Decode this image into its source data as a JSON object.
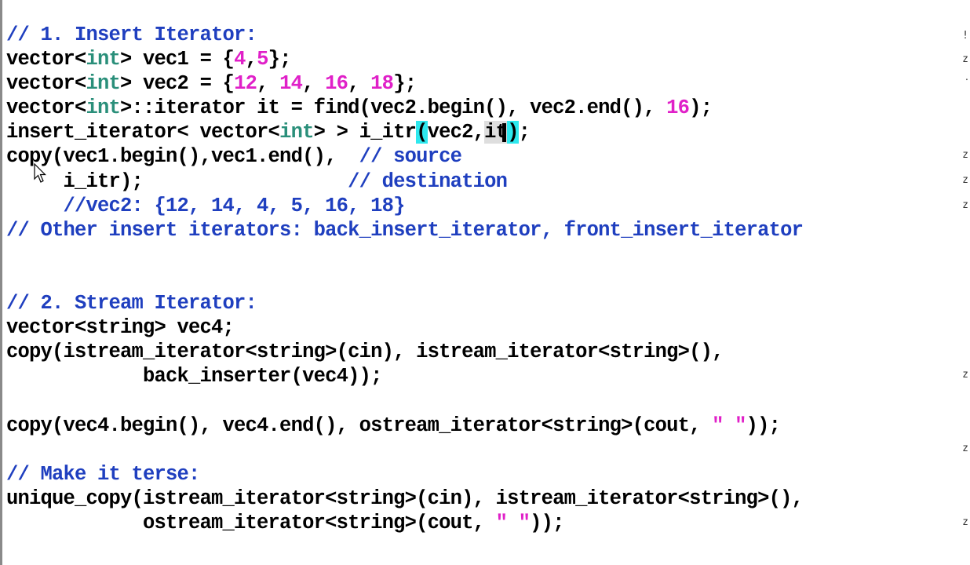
{
  "lines": [
    {
      "id": "l1",
      "parts": [
        {
          "t": "// 1. Insert Iterator:",
          "c": "cm"
        }
      ]
    },
    {
      "id": "l2",
      "parts": [
        {
          "t": "vector<"
        },
        {
          "t": "int",
          "c": "kw"
        },
        {
          "t": "> vec1 = {"
        },
        {
          "t": "4",
          "c": "num"
        },
        {
          "t": ","
        },
        {
          "t": "5",
          "c": "num"
        },
        {
          "t": "};"
        }
      ]
    },
    {
      "id": "l3",
      "parts": [
        {
          "t": "vector<"
        },
        {
          "t": "int",
          "c": "kw"
        },
        {
          "t": "> vec2 = {"
        },
        {
          "t": "12",
          "c": "num"
        },
        {
          "t": ", "
        },
        {
          "t": "14",
          "c": "num"
        },
        {
          "t": ", "
        },
        {
          "t": "16",
          "c": "num"
        },
        {
          "t": ", "
        },
        {
          "t": "18",
          "c": "num"
        },
        {
          "t": "};"
        }
      ]
    },
    {
      "id": "l4",
      "parts": [
        {
          "t": "vector<"
        },
        {
          "t": "int",
          "c": "kw"
        },
        {
          "t": ">::iterator it = find(vec2.begin(), vec2.end(), "
        },
        {
          "t": "16",
          "c": "num"
        },
        {
          "t": ");"
        }
      ]
    },
    {
      "id": "l5",
      "parts": [
        {
          "t": "insert_iterator< vector<"
        },
        {
          "t": "int",
          "c": "kw"
        },
        {
          "t": "> > i_itr"
        },
        {
          "t": "(",
          "c": "hl-cyan"
        },
        {
          "t": "vec2,"
        },
        {
          "t": "it",
          "c": "hl-gray"
        },
        {
          "t": "CARET"
        },
        {
          "t": ")",
          "c": "hl-cyan"
        },
        {
          "t": ";"
        }
      ]
    },
    {
      "id": "l6",
      "parts": [
        {
          "t": "copy(vec1.begin(),vec1.end(),  "
        },
        {
          "t": "// source",
          "c": "cm"
        }
      ]
    },
    {
      "id": "l7",
      "parts": [
        {
          "t": "     i_itr);                  "
        },
        {
          "t": "// destination",
          "c": "cm"
        }
      ]
    },
    {
      "id": "l8",
      "parts": [
        {
          "t": "     //vec2: {12, 14, 4, 5, 16, 18}",
          "c": "cm"
        }
      ]
    },
    {
      "id": "l9",
      "parts": [
        {
          "t": "// Other insert iterators: back_insert_iterator, front_insert_iterator",
          "c": "cm"
        }
      ]
    },
    {
      "id": "l10",
      "parts": [
        {
          "t": ""
        }
      ]
    },
    {
      "id": "l11",
      "parts": [
        {
          "t": ""
        }
      ]
    },
    {
      "id": "l12",
      "parts": [
        {
          "t": "// 2. Stream Iterator:",
          "c": "cm"
        }
      ]
    },
    {
      "id": "l13",
      "parts": [
        {
          "t": "vector<string> vec4;"
        }
      ]
    },
    {
      "id": "l14",
      "parts": [
        {
          "t": "copy(istream_iterator<string>(cin), istream_iterator<string>(),"
        }
      ]
    },
    {
      "id": "l15",
      "parts": [
        {
          "t": "            back_inserter(vec4));"
        }
      ]
    },
    {
      "id": "l16",
      "parts": [
        {
          "t": ""
        }
      ]
    },
    {
      "id": "l17",
      "parts": [
        {
          "t": "copy(vec4.begin(), vec4.end(), ostream_iterator<string>(cout, "
        },
        {
          "t": "\" \"",
          "c": "str"
        },
        {
          "t": "));"
        }
      ]
    },
    {
      "id": "l18",
      "parts": [
        {
          "t": ""
        }
      ]
    },
    {
      "id": "l19",
      "parts": [
        {
          "t": "// Make it terse:",
          "c": "cm"
        }
      ]
    },
    {
      "id": "l20",
      "parts": [
        {
          "t": "unique_copy(istream_iterator<string>(cin), istream_iterator<string>(),"
        }
      ]
    },
    {
      "id": "l21",
      "parts": [
        {
          "t": "            ostream_iterator<string>(cout, "
        },
        {
          "t": "\" \"",
          "c": "str"
        },
        {
          "t": "));"
        }
      ]
    }
  ],
  "gutter_marks": [
    {
      "text": "!",
      "line": 0
    },
    {
      "text": "z",
      "line": 1
    },
    {
      "text": "‧",
      "line": 2
    },
    {
      "text": "z",
      "line": 5
    },
    {
      "text": "z",
      "line": 6
    },
    {
      "text": "z",
      "line": 7
    },
    {
      "text": "z",
      "line": 14
    },
    {
      "text": "z",
      "line": 17
    },
    {
      "text": "z",
      "line": 20
    }
  ],
  "colors": {
    "comment": "#1f3fbf",
    "keyword": "#2a8f7a",
    "number": "#e020c8",
    "highlight": "#2ee8ee"
  }
}
